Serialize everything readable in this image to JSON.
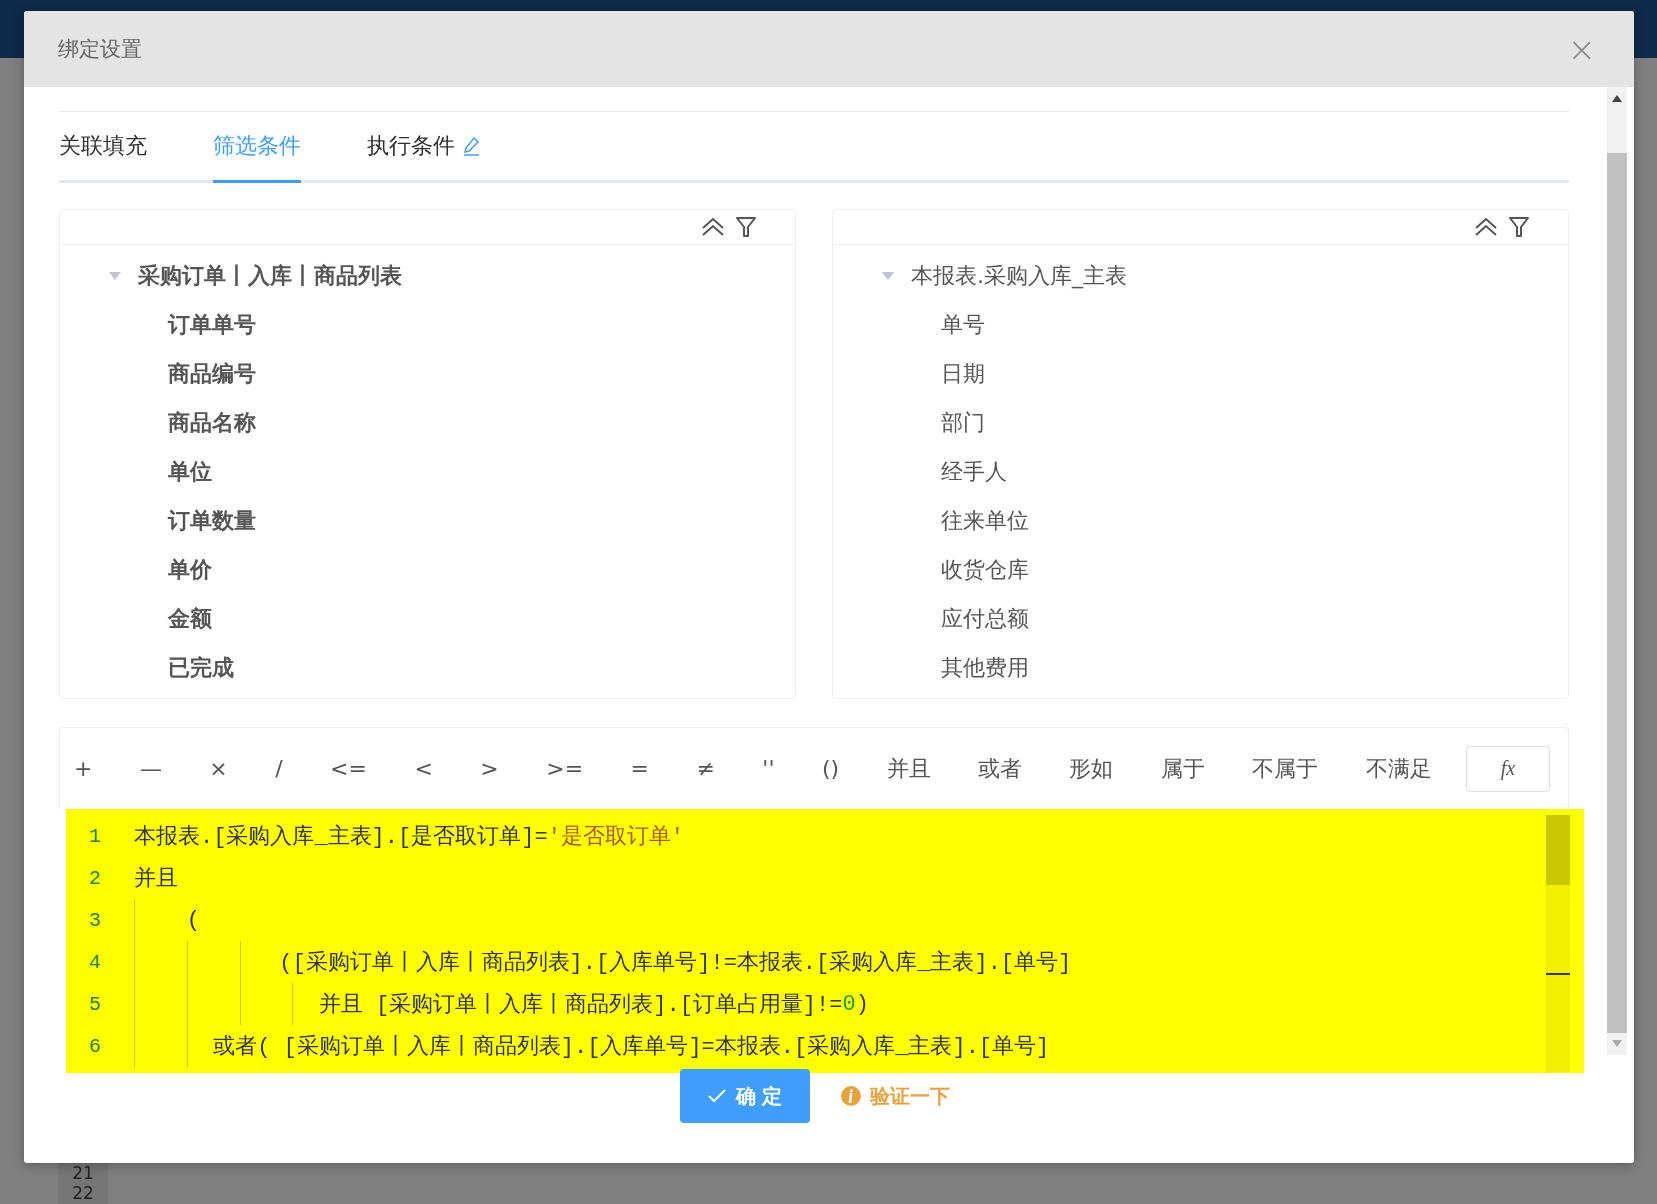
{
  "backdrop": {
    "line_numbers": [
      "21",
      "22"
    ]
  },
  "dialog": {
    "title": "绑定设置",
    "close": "×"
  },
  "tabs": [
    {
      "label": "关联填充",
      "selected": false,
      "editable": false
    },
    {
      "label": "筛选条件",
      "selected": true,
      "editable": false
    },
    {
      "label": "执行条件",
      "selected": false,
      "editable": true
    }
  ],
  "left_tree": {
    "label": "采购订单丨入库丨商品列表",
    "expanded": true,
    "bold": true,
    "children": [
      {
        "label": "订单单号"
      },
      {
        "label": "商品编号"
      },
      {
        "label": "商品名称"
      },
      {
        "label": "单位"
      },
      {
        "label": "订单数量"
      },
      {
        "label": "单价"
      },
      {
        "label": "金额"
      },
      {
        "label": "已完成"
      }
    ]
  },
  "right_tree": {
    "label": "本报表.采购入库_主表",
    "expanded": true,
    "bold": false,
    "children": [
      {
        "label": "单号"
      },
      {
        "label": "日期"
      },
      {
        "label": "部门"
      },
      {
        "label": "经手人"
      },
      {
        "label": "往来单位"
      },
      {
        "label": "收货仓库"
      },
      {
        "label": "应付总额"
      },
      {
        "label": "其他费用"
      }
    ]
  },
  "operators": [
    "+",
    "—",
    "×",
    "/",
    "<=",
    "<",
    ">",
    ">=",
    "=",
    "≠",
    "''",
    "()",
    "并且",
    "或者",
    "形如",
    "属于",
    "不属于",
    "不满足"
  ],
  "function_button": "fx",
  "code_lines": [
    {
      "number": "1",
      "segments": [
        {
          "kind": "text",
          "text": "本报表.[采购入库_主表].[是否取订单]="
        },
        {
          "kind": "string",
          "text": "'是否取订单'"
        }
      ]
    },
    {
      "number": "2",
      "segments": [
        {
          "kind": "text",
          "text": "并且"
        }
      ]
    },
    {
      "number": "3",
      "segments": [
        {
          "kind": "text",
          "text": "    ("
        }
      ]
    },
    {
      "number": "4",
      "segments": [
        {
          "kind": "text",
          "text": "           ([采购订单丨入库丨商品列表].[入库单号]!=本报表.[采购入库_主表].[单号]"
        }
      ]
    },
    {
      "number": "5",
      "segments": [
        {
          "kind": "text",
          "text": "              并且 [采购订单丨入库丨商品列表].[订单占用量]!="
        },
        {
          "kind": "number",
          "text": "0"
        },
        {
          "kind": "text",
          "text": ")"
        }
      ]
    },
    {
      "number": "6",
      "segments": [
        {
          "kind": "text",
          "text": "      或者( [采购订单丨入库丨商品列表].[入库单号]=本报表.[采购入库_主表].[单号]"
        }
      ]
    }
  ],
  "buttons": [
    {
      "kind": "primary",
      "label": "确 定"
    },
    {
      "kind": "link",
      "label": "验证一下"
    }
  ]
}
